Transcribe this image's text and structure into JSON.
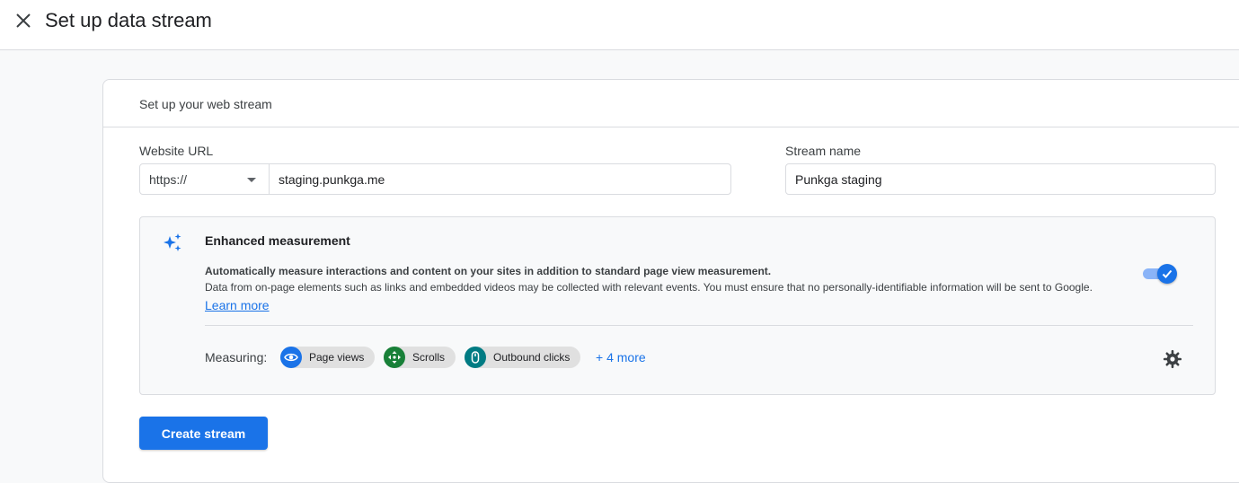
{
  "header": {
    "title": "Set up data stream",
    "close_icon": "close-icon"
  },
  "card": {
    "header": "Set up your web stream",
    "website_url": {
      "label": "Website URL",
      "protocol": "https://",
      "value": "staging.punkga.me"
    },
    "stream_name": {
      "label": "Stream name",
      "value": "Punkga staging"
    },
    "enhanced_measurement": {
      "icon": "sparkle-icon",
      "title": "Enhanced measurement",
      "description_bold": "Automatically measure interactions and content on your sites in addition to standard page view measurement.",
      "description": "Data from on-page elements such as links and embedded videos may be collected with relevant events. You must ensure that no personally-identifiable information will be sent to Google.",
      "learn_more": "Learn more",
      "enabled": true,
      "measuring_label": "Measuring:",
      "chips": [
        {
          "label": "Page views",
          "icon": "eye-icon",
          "color": "#1a73e8"
        },
        {
          "label": "Scrolls",
          "icon": "scroll-arrows-icon",
          "color": "#188038"
        },
        {
          "label": "Outbound clicks",
          "icon": "mouse-icon",
          "color": "#007b83"
        }
      ],
      "more": "+ 4 more",
      "settings_icon": "gear-icon"
    },
    "create_button": "Create stream"
  },
  "colors": {
    "accent": "#1a73e8",
    "border": "#dadce0",
    "background": "#f8f9fa"
  }
}
